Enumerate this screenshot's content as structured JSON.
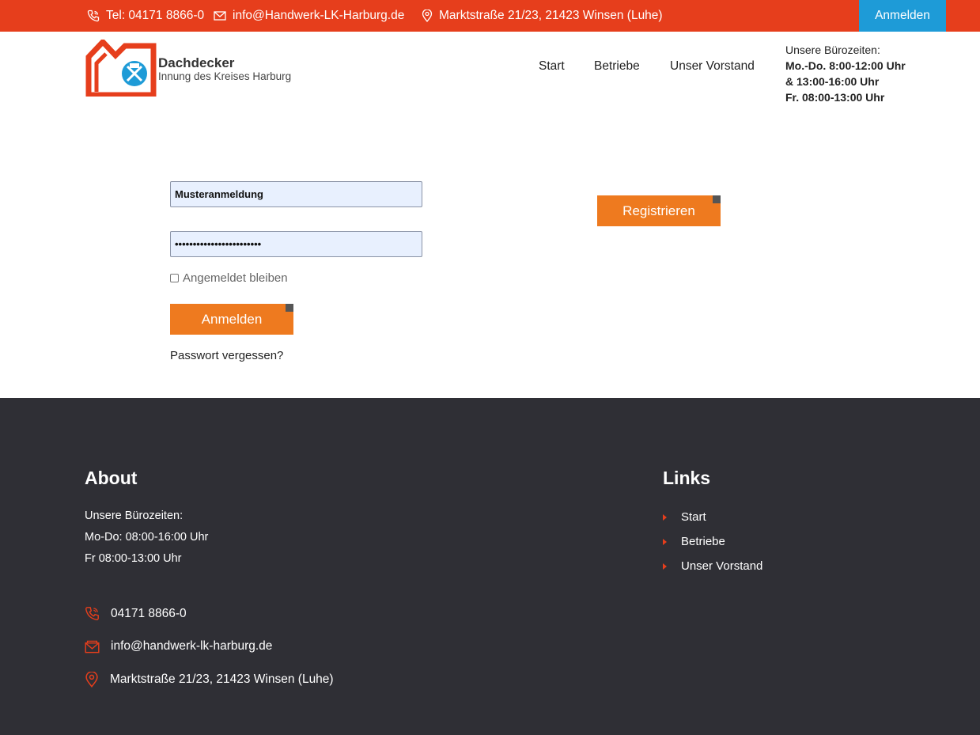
{
  "topbar": {
    "phone": "Tel: 04171 8866-0",
    "email": "info@Handwerk-LK-Harburg.de",
    "address": "Marktstraße 21/23, 21423 Winsen (Luhe)",
    "login_label": "Anmelden",
    "bg_color": "#e63e1c",
    "login_color": "#1e9bd7"
  },
  "header": {
    "brand": "Dachdecker",
    "subtitle": "Innung des Kreises Harburg",
    "nav": [
      "Start",
      "Betriebe",
      "Unser Vorstand"
    ],
    "hours_title": "Unsere Bürozeiten:",
    "hours_lines": [
      "Mo.-Do. 8:00-12:00 Uhr",
      "& 13:00-16:00 Uhr",
      "Fr. 08:00-13:00 Uhr"
    ]
  },
  "form": {
    "username_value": "Musteranmeldung",
    "password_value": "••••••••••••••••••••••••",
    "remember_label": "Angemeldet bleiben",
    "login_button": "Anmelden",
    "forgot_label": "Passwort vergessen?",
    "register_button": "Registrieren",
    "button_color": "#ee7a1f"
  },
  "footer": {
    "about_title": "About",
    "about_lines": [
      "Unsere Bürozeiten:",
      "Mo-Do: 08:00-16:00 Uhr",
      "Fr 08:00-13:00 Uhr"
    ],
    "phone": "04171 8866-0",
    "email": "info@handwerk-lk-harburg.de",
    "address": "Marktstraße 21/23, 21423 Winsen (Luhe)",
    "links_title": "Links",
    "links": [
      "Start",
      "Betriebe",
      "Unser Vorstand"
    ],
    "bg_color": "#2f2f35"
  }
}
